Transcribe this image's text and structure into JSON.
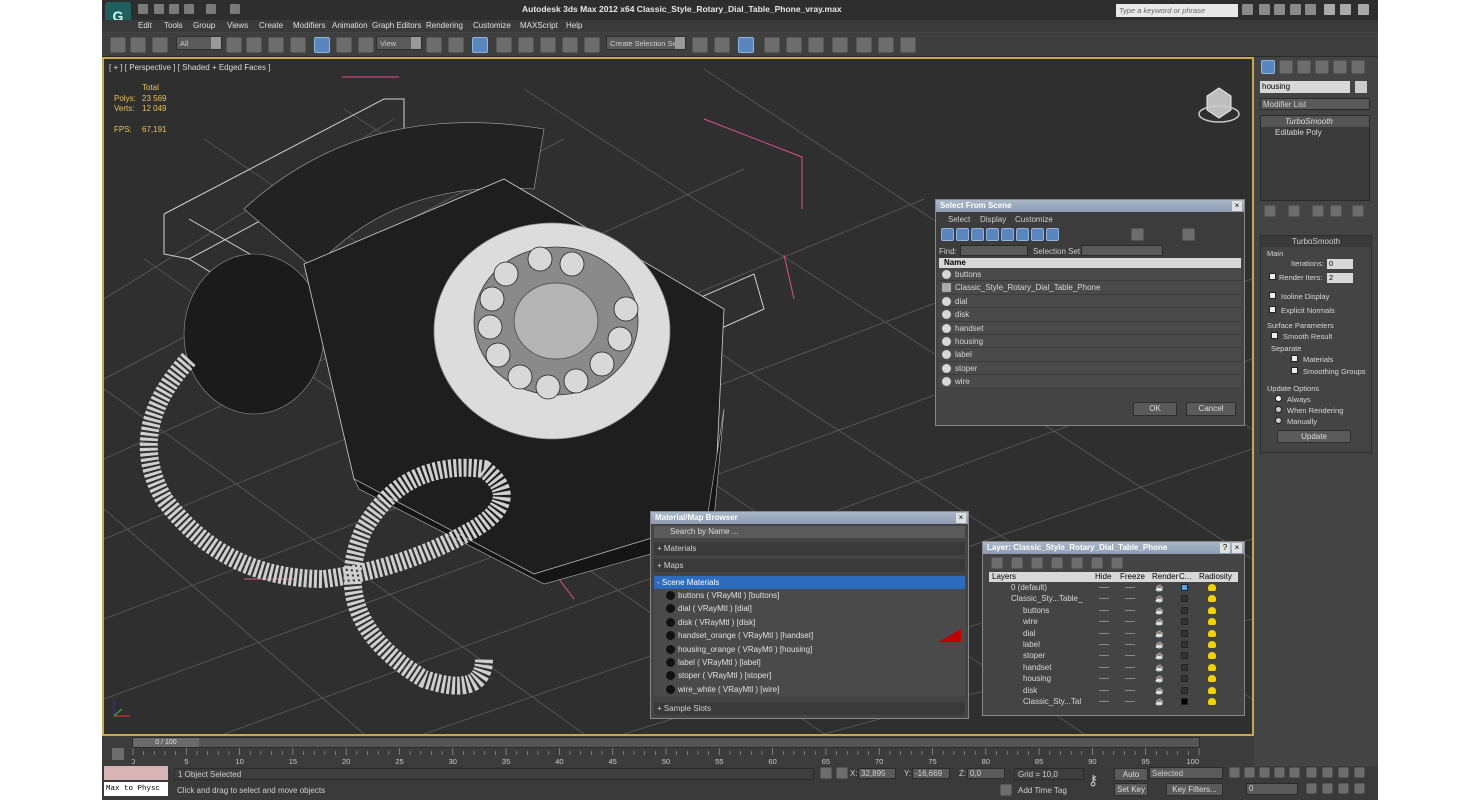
{
  "window": {
    "title": "Autodesk 3ds Max  2012 x64    Classic_Style_Rotary_Dial_Table_Phone_vray.max",
    "search_placeholder": "Type a keyword or phrase"
  },
  "menu": [
    "Edit",
    "Tools",
    "Group",
    "Views",
    "Create",
    "Modifiers",
    "Animation",
    "Graph Editors",
    "Rendering",
    "Customize",
    "MAXScript",
    "Help"
  ],
  "toolbar": {
    "filter": "All",
    "ref_coord": "View",
    "named_sel": "Create Selection Se"
  },
  "viewport": {
    "label": "[ + ] [ Perspective ] [ Shaded + Edged Faces ]",
    "stats": {
      "total": "Total",
      "polys_label": "Polys:",
      "polys": "23 569",
      "verts_label": "Verts:",
      "verts": "12 049",
      "fps_label": "FPS:",
      "fps": "67,191"
    }
  },
  "select_scene": {
    "title": "Select From Scene",
    "menu": [
      "Select",
      "Display",
      "Customize"
    ],
    "find_label": "Find:",
    "selset_label": "Selection Set:",
    "col_name": "Name",
    "items": [
      "buttons",
      "Classic_Style_Rotary_Dial_Table_Phone",
      "dial",
      "disk",
      "handset",
      "housing",
      "label",
      "stoper",
      "wire"
    ],
    "ok": "OK",
    "cancel": "Cancel"
  },
  "material_browser": {
    "title": "Material/Map Browser",
    "search": "Search by Name ...",
    "sections": {
      "materials": "+ Materials",
      "maps": "+ Maps",
      "scene": "- Scene Materials",
      "sample": "+ Sample Slots"
    },
    "items": [
      "buttons  ( VRayMtl ) [buttons]",
      "dial  ( VRayMtl ) [dial]",
      "disk  ( VRayMtl ) [disk]",
      "handset_orange  ( VRayMtl ) [handset]",
      "housing_orange  ( VRayMtl ) [housing]",
      "label  ( VRayMtl ) [label]",
      "stoper  ( VRayMtl ) [stoper]",
      "wire_white  ( VRayMtl ) [wire]"
    ]
  },
  "layer_panel": {
    "title": "Layer: Classic_Style_Rotary_Dial_Table_Phone",
    "cols": {
      "layers": "Layers",
      "hide": "Hide",
      "freeze": "Freeze",
      "render": "Render",
      "color": "C...",
      "radiosity": "Radiosity"
    },
    "rows": [
      "0 (default)",
      "Classic_Sty...Table_",
      "buttons",
      "wire",
      "dial",
      "label",
      "stoper",
      "handset",
      "housing",
      "disk",
      "Classic_Sty...Tal"
    ]
  },
  "command_panel": {
    "object_name": "housing",
    "modifier_list": "Modifier List",
    "stack": [
      "TurboSmooth",
      "Editable Poly"
    ],
    "rollout": "TurboSmooth",
    "main": "Main",
    "iterations_label": "Iterations:",
    "iterations": "0",
    "render_iters_label": "Render Iters:",
    "render_iters": "2",
    "isoline": "Isoline Display",
    "explicit": "Explicit Normals",
    "surface": "Surface Parameters",
    "smooth_result": "Smooth Result",
    "separate": "Separate",
    "materials": "Materials",
    "smoothing": "Smoothing Groups",
    "update_options": "Update Options",
    "always": "Always",
    "when_rendering": "When Rendering",
    "manually": "Manually",
    "update": "Update"
  },
  "timeline": {
    "frame": "0 / 100",
    "ticks": [
      "0",
      "5",
      "10",
      "15",
      "20",
      "25",
      "30",
      "35",
      "40",
      "45",
      "50",
      "55",
      "60",
      "65",
      "70",
      "75",
      "80",
      "85",
      "90",
      "95",
      "100"
    ]
  },
  "status": {
    "script": "Max to Physc",
    "selected": "1 Object Selected",
    "prompt": "Click and drag to select and move objects",
    "x_label": "X:",
    "x": "32,895",
    "y_label": "Y:",
    "y": "-16,669",
    "z_label": "Z:",
    "z": "0,0",
    "grid": "Grid = 10,0",
    "add_tag": "Add Time Tag",
    "autokey": "Auto Key",
    "setkey": "Set Key",
    "key_mode": "Selected",
    "key_filters": "Key Filters...",
    "frame_field": "0"
  }
}
